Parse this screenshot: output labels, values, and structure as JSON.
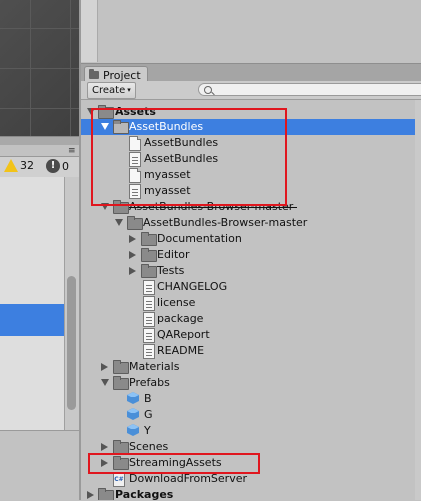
{
  "project_panel": {
    "tab_label": "Project",
    "create_label": "Create",
    "create_arrow": "▾",
    "search_value": ""
  },
  "console": {
    "menu_icon": "≡",
    "warning_count": "32",
    "error_count": "0",
    "error_glyph": "!"
  },
  "tree": {
    "assets": "Assets",
    "asset_bundles": "AssetBundles",
    "asset_bundles_file_1": "AssetBundles",
    "asset_bundles_file_2": "AssetBundles",
    "myasset_1": "myasset",
    "myasset_2": "myasset",
    "browser_master": "AssetBundles-Browser-master",
    "browser_master_inner": "AssetBundles-Browser-master",
    "documentation": "Documentation",
    "editor": "Editor",
    "tests": "Tests",
    "changelog": "CHANGELOG",
    "license": "license",
    "package": "package",
    "qareport": "QAReport",
    "readme": "README",
    "materials": "Materials",
    "prefabs": "Prefabs",
    "prefab_b": "B",
    "prefab_g": "G",
    "prefab_y": "Y",
    "scenes": "Scenes",
    "streaming_assets": "StreamingAssets",
    "download_script": "DownloadFromServer",
    "cs_label": "C#",
    "packages": "Packages"
  },
  "colors": {
    "selection": "#3d7fe0",
    "highlight_box": "#e0161e",
    "warning": "#f2c318"
  },
  "icons": {
    "folder": "folder-icon",
    "file": "file-icon",
    "text_file": "text-file-icon",
    "prefab": "prefab-cube-icon",
    "script": "csharp-script-icon",
    "warning": "warning-icon",
    "error": "error-icon",
    "search": "search-icon"
  }
}
